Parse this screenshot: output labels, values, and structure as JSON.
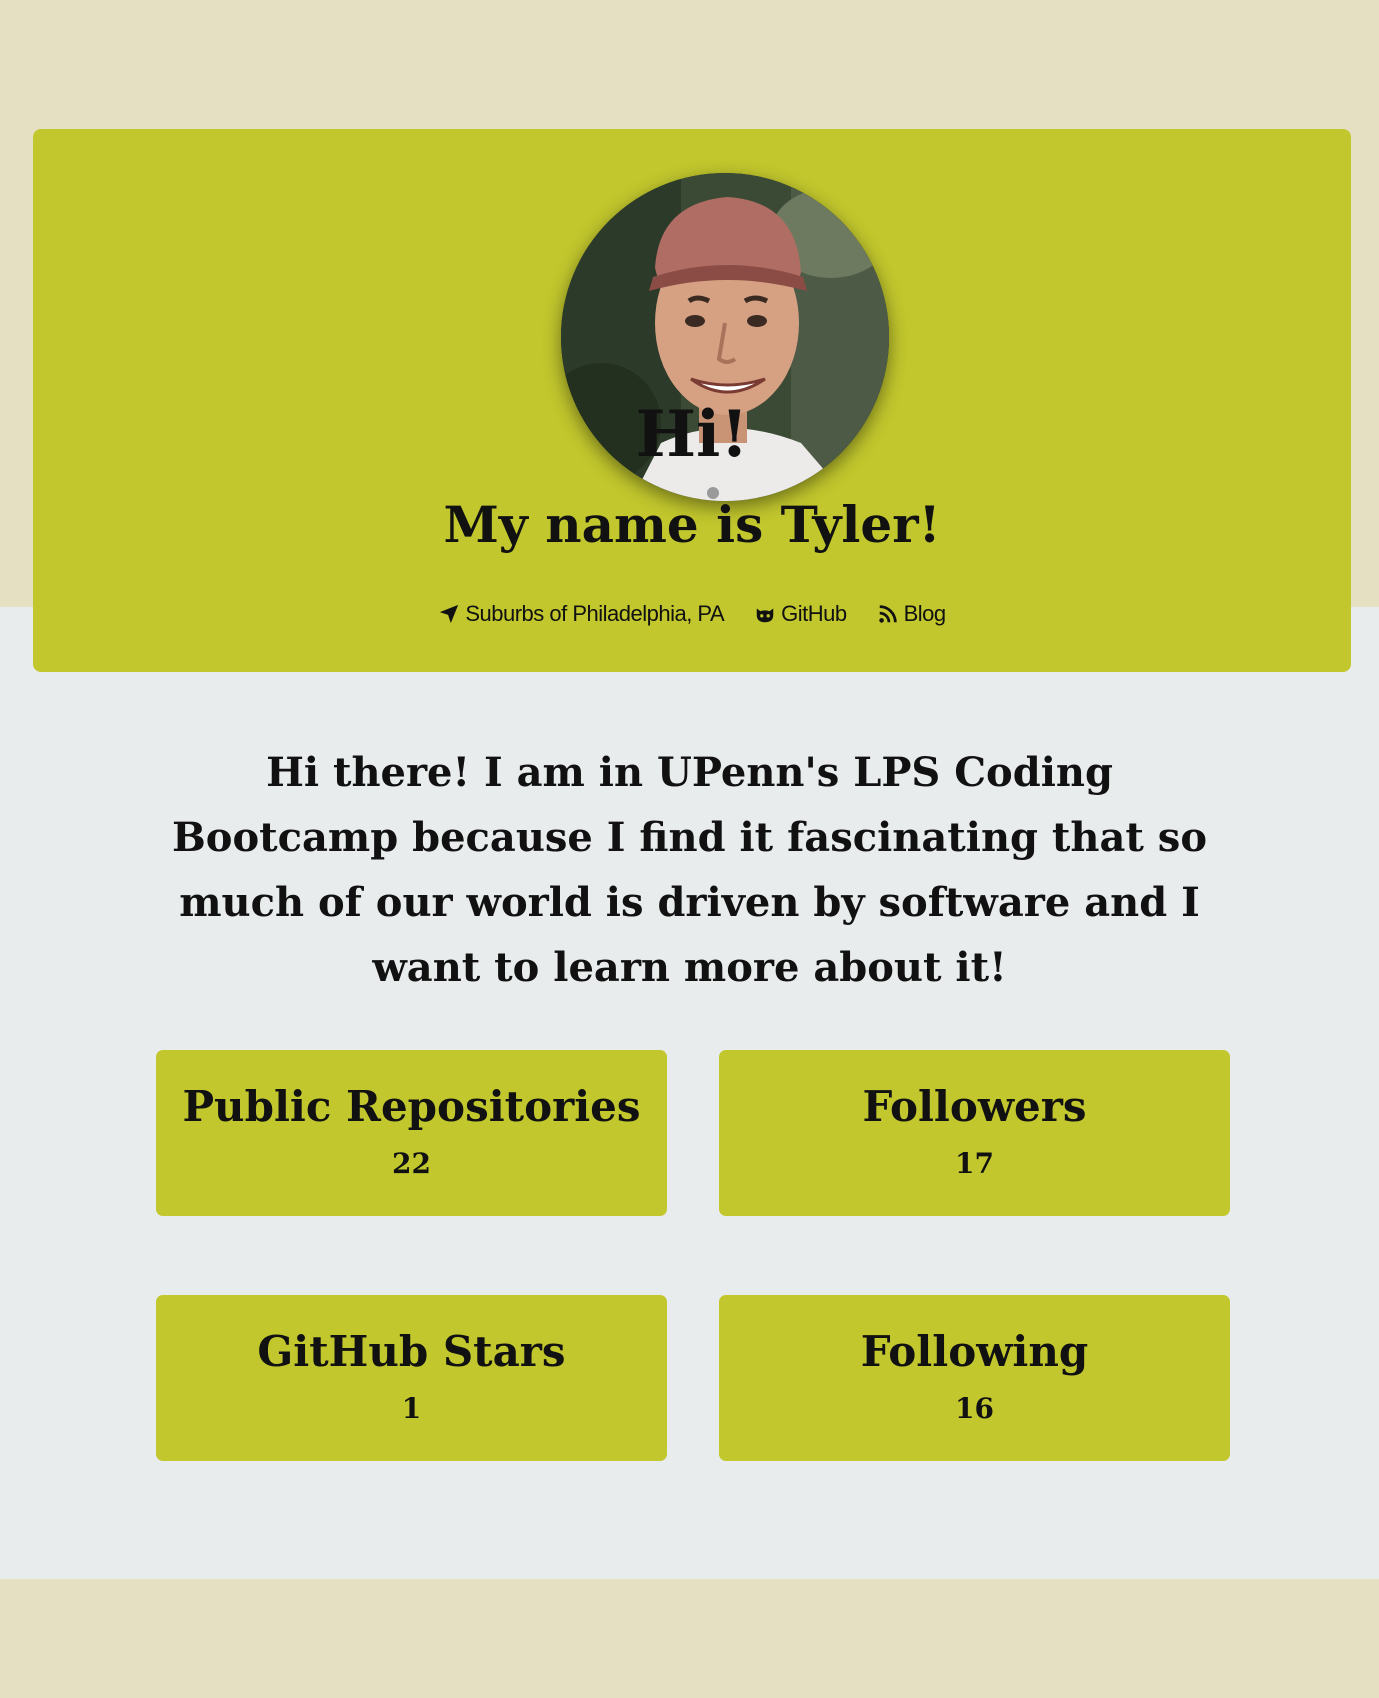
{
  "hero": {
    "greeting": "Hi!",
    "name_line": "My name is Tyler!",
    "avatar_icon": "profile-photo",
    "links": {
      "location": {
        "label": "Suburbs of Philadelphia, PA",
        "icon": "location-arrow-icon"
      },
      "github": {
        "label": "GitHub",
        "icon": "github-icon"
      },
      "blog": {
        "label": "Blog",
        "icon": "rss-icon"
      }
    }
  },
  "bio": "Hi there! I am in UPenn's LPS Coding Bootcamp because I find it fascinating that so much of our world is driven by software and I want to learn more about it!",
  "stats": [
    {
      "label": "Public Repositories",
      "value": "22"
    },
    {
      "label": "Followers",
      "value": "17"
    },
    {
      "label": "GitHub Stars",
      "value": "1"
    },
    {
      "label": "Following",
      "value": "16"
    }
  ],
  "colors": {
    "accent": "#c2c72d",
    "page_band": "#e5e0c2",
    "content_bg": "#e9ecec",
    "text": "#111111"
  }
}
